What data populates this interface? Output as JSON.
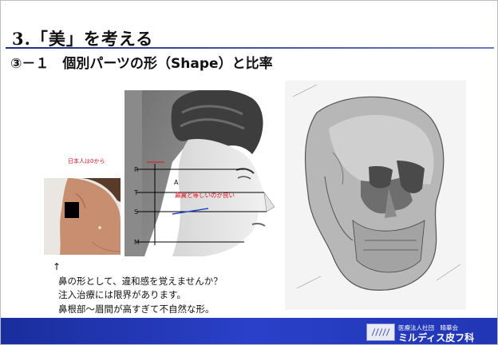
{
  "header": {
    "title": "3.「美」を考える",
    "subtitle": "③－１　個別パーツの形（Shape）と比率"
  },
  "portrait": {
    "markers": [
      "R",
      "T",
      "S",
      "M",
      "A"
    ],
    "annotation_japanese": "日本人は0から",
    "annotation_nose": "鼻翼と等しいのが良い"
  },
  "body": {
    "arrow": "↑",
    "lines": [
      "鼻の形として、違和感を覚えませんか？",
      "注入治療には限界があります。",
      "鼻根部～眉間が高すぎて不自然な形。"
    ]
  },
  "footer": {
    "organization": "医療法人社団　晴華会",
    "clinic": "ミルディス皮フ科"
  },
  "colors": {
    "accent_red": "#e0141e",
    "footer_blue": "#2a40c8",
    "title_rule": "#1c2c8c"
  }
}
